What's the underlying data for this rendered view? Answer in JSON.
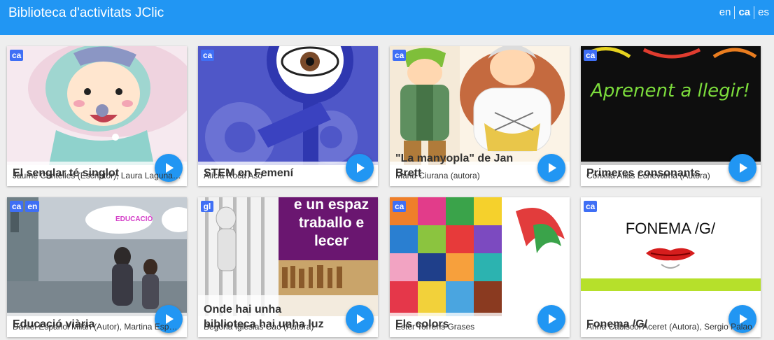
{
  "header": {
    "title": "Biblioteca d'activitats JClic",
    "languages": [
      "en",
      "ca",
      "es"
    ],
    "active_language": "ca"
  },
  "cards": [
    {
      "title": "El senglar té singlot",
      "author": "Jaume Centelles (Escriptor), Laura Lagunas (Il·lustradora)",
      "langs": [
        "ca"
      ]
    },
    {
      "title": "STEM en Femení",
      "author": "Alícia Roca Aso",
      "langs": [
        "ca"
      ]
    },
    {
      "title": "\"La manyopla\" de Jan Brett",
      "author": "Maria Ciurana (autora)",
      "langs": [
        "ca"
      ]
    },
    {
      "title": "Primeres consonants",
      "author": "Conxita Alias Echevarria (Autora)",
      "langs": [
        "ca"
      ]
    },
    {
      "title": "Educació viària",
      "author": "Daniel Español Milán (Autor), Martina Espanyol",
      "langs": [
        "ca",
        "en"
      ]
    },
    {
      "title": "Onde hai unha biblioteca hai unha luz",
      "author": "Begoña Iglesias Cao (Autora)",
      "langs": [
        "gl"
      ]
    },
    {
      "title": "Els colors",
      "author": "Ester Torrens Grases",
      "langs": [
        "ca"
      ]
    },
    {
      "title": "Fonema /G/",
      "author": "Anna Cabiscol Aceret (Autora), Sergio Palao",
      "langs": [
        "ca"
      ]
    }
  ],
  "thumbnails": {
    "card4": "Aprenent a llegir!",
    "card5": "EDUCACIÓ",
    "card6_line1": "e un espaz",
    "card6_line2": "traballo e",
    "card6_line3": "lecer",
    "card8": "FONEMA /G/"
  },
  "colors": {
    "header": "#2196f3",
    "badge": "#3f6ff5",
    "play": "#2196f3",
    "background": "#eeeeee"
  }
}
